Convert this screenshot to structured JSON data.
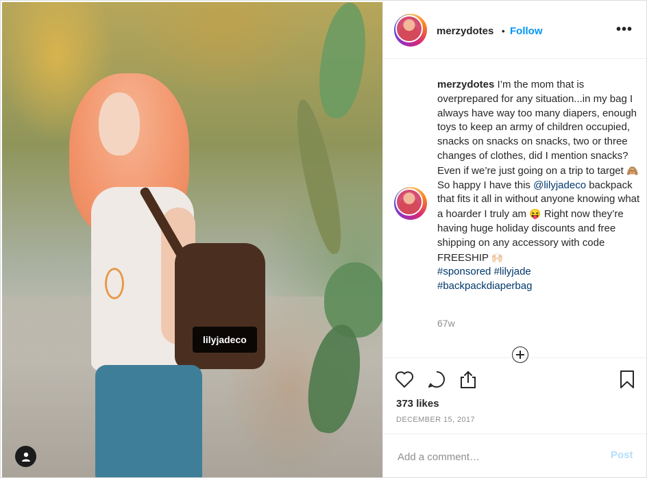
{
  "post": {
    "photo": {
      "tag_label": "lilyjadeco"
    },
    "author": {
      "username": "merzydotes",
      "separator": "•",
      "follow_label": "Follow"
    },
    "caption": {
      "username": "merzydotes",
      "part1": "I’m the mom that is overprepared for any situation...in my bag I always have way too many diapers, enough toys to keep an army of children occupied, snacks on snacks on snacks, two or three changes of clothes, did I mention snacks? Even if we’re just going on a trip to target",
      "emoji1": "🙈",
      "part2": "So happy I have this",
      "mention": "@lilyjadeco",
      "part3": "backpack that fits it all in without anyone knowing what a hoarder I truly am",
      "emoji2": "😝",
      "part4": "Right now they’re having huge holiday discounts and free shipping on any accessory with code FREESHIP",
      "emoji3": "🙌🏻",
      "hashtags": [
        "#sponsored",
        "#lilyjade",
        "#backpackdiaperbag"
      ]
    },
    "time_ago": "67w",
    "likes": "373 likes",
    "date": "DECEMBER 15, 2017",
    "comment": {
      "placeholder": "Add a comment…",
      "value": "",
      "post_label": "Post"
    },
    "icons": [
      "heart-icon",
      "comment-icon",
      "share-icon",
      "bookmark-icon",
      "more-options-icon",
      "user-tag-icon",
      "load-more-comments-icon"
    ],
    "colors": {
      "link_blue": "#0095f6",
      "mention_blue": "#00376b",
      "muted_gray": "#8e8e8e",
      "post_disabled": "#b2dffc"
    }
  }
}
